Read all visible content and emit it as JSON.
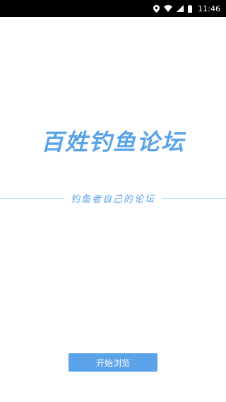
{
  "status_bar": {
    "time": "11:46",
    "icons": [
      "location-icon",
      "wifi-icon",
      "signal-icon",
      "battery-icon"
    ]
  },
  "colors": {
    "accent": "#5aa3e8",
    "divider": "#9cc6ef",
    "status_bar_bg": "#000000"
  },
  "splash": {
    "title": "百姓钓鱼论坛",
    "subtitle": "钓鱼者自己的论坛",
    "start_button_label": "开始浏览"
  }
}
